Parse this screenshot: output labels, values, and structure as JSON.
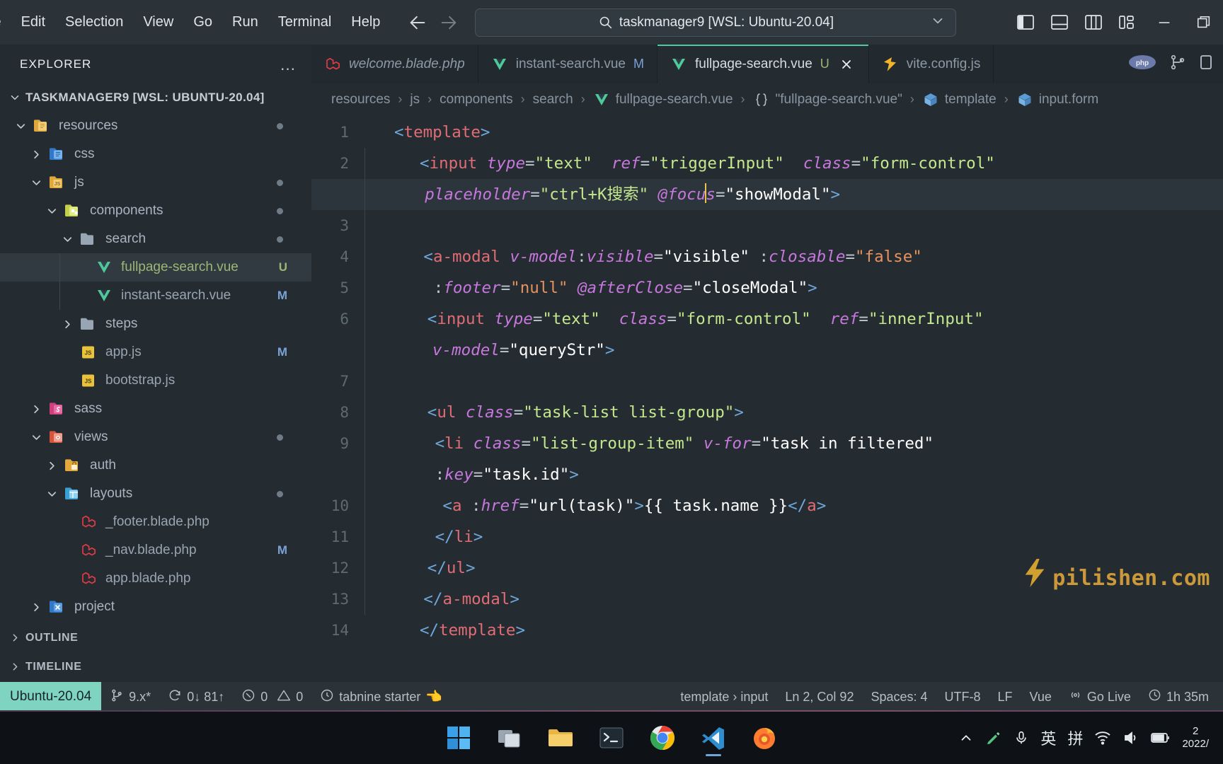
{
  "titlebar": {
    "menus": [
      "le",
      "Edit",
      "Selection",
      "View",
      "Go",
      "Run",
      "Terminal",
      "Help"
    ],
    "back_icon": "arrow-left-icon",
    "forward_icon": "arrow-right-icon",
    "search_value": "taskmanager9 [WSL: Ubuntu-20.04]",
    "search_icon": "search-icon",
    "chevron_icon": "chevron-down-icon",
    "layout_icons": [
      "toggle-primary-sidebar-icon",
      "toggle-panel-icon",
      "toggle-secondary-sidebar-icon",
      "customize-layout-icon"
    ],
    "minimize": "minimize-icon",
    "maximize": "maximize-icon"
  },
  "sidebar": {
    "title": "EXPLORER",
    "more_actions": "…",
    "root": "TASKMANAGER9 [WSL: UBUNTU-20.04]",
    "tree": [
      {
        "label": "resources",
        "icon": "folder-resources-icon",
        "indent": 1,
        "arrow": "down",
        "kind": "folder",
        "dot": true
      },
      {
        "label": "css",
        "icon": "folder-css-icon",
        "indent": 2,
        "arrow": "right",
        "kind": "folder"
      },
      {
        "label": "js",
        "icon": "folder-js-icon",
        "indent": 2,
        "arrow": "down",
        "kind": "folder",
        "dot": true
      },
      {
        "label": "components",
        "icon": "folder-components-icon",
        "indent": 3,
        "arrow": "down",
        "kind": "folder",
        "dot": true
      },
      {
        "label": "search",
        "icon": "folder-plain-icon",
        "indent": 4,
        "arrow": "down",
        "kind": "folder",
        "dot": true
      },
      {
        "label": "fullpage-search.vue",
        "icon": "vue-file-icon",
        "indent": 5,
        "arrow": "none",
        "kind": "file-vue",
        "badge": "U",
        "badge_color": "#9bb774",
        "selected": true
      },
      {
        "label": "instant-search.vue",
        "icon": "vue-file-icon",
        "indent": 5,
        "arrow": "none",
        "kind": "file-vue",
        "badge": "M",
        "badge_color": "#7aa2d6"
      },
      {
        "label": "steps",
        "icon": "folder-plain-icon",
        "indent": 4,
        "arrow": "right",
        "kind": "folder"
      },
      {
        "label": "app.js",
        "icon": "js-file-icon",
        "indent": 4,
        "arrow": "none",
        "kind": "file",
        "badge": "M",
        "badge_color": "#7aa2d6"
      },
      {
        "label": "bootstrap.js",
        "icon": "js-file-icon",
        "indent": 4,
        "arrow": "none",
        "kind": "file"
      },
      {
        "label": "sass",
        "icon": "folder-sass-icon",
        "indent": 2,
        "arrow": "right",
        "kind": "folder"
      },
      {
        "label": "views",
        "icon": "folder-views-icon",
        "indent": 2,
        "arrow": "down",
        "kind": "folder",
        "dot": true
      },
      {
        "label": "auth",
        "icon": "folder-auth-icon",
        "indent": 3,
        "arrow": "right",
        "kind": "folder"
      },
      {
        "label": "layouts",
        "icon": "folder-layouts-icon",
        "indent": 3,
        "arrow": "down",
        "kind": "folder",
        "dot": true
      },
      {
        "label": "_footer.blade.php",
        "icon": "laravel-file-icon",
        "indent": 4,
        "arrow": "none",
        "kind": "file"
      },
      {
        "label": "_nav.blade.php",
        "icon": "laravel-file-icon",
        "indent": 4,
        "arrow": "none",
        "kind": "file",
        "badge": "M",
        "badge_color": "#7aa2d6"
      },
      {
        "label": "app.blade.php",
        "icon": "laravel-file-icon",
        "indent": 4,
        "arrow": "none",
        "kind": "file"
      },
      {
        "label": "project",
        "icon": "folder-project-icon",
        "indent": 2,
        "arrow": "right",
        "kind": "folder"
      }
    ],
    "sections": [
      "OUTLINE",
      "TIMELINE"
    ]
  },
  "tabs": [
    {
      "label": "welcome.blade.php",
      "icon": "laravel-file-icon",
      "italic": true,
      "active": false,
      "mark": ""
    },
    {
      "label": "instant-search.vue",
      "icon": "vue-file-icon",
      "italic": false,
      "active": false,
      "mark": "M",
      "mark_color": "#7aa2d6"
    },
    {
      "label": "fullpage-search.vue",
      "icon": "vue-file-icon",
      "italic": false,
      "active": true,
      "mark": "U",
      "mark_color": "#9bb774",
      "closable": true
    },
    {
      "label": "vite.config.js",
      "icon": "vite-file-icon",
      "italic": false,
      "active": false,
      "mark": ""
    }
  ],
  "tab_actions": [
    "php-badge-icon",
    "split-editor-icon",
    "more-actions-icon"
  ],
  "breadcrumb": [
    {
      "label": "resources",
      "icon": ""
    },
    {
      "label": "js",
      "icon": ""
    },
    {
      "label": "components",
      "icon": ""
    },
    {
      "label": "search",
      "icon": ""
    },
    {
      "label": "fullpage-search.vue",
      "icon": "vue-file-icon"
    },
    {
      "label": "\"fullpage-search.vue\"",
      "icon": "braces-icon"
    },
    {
      "label": "template",
      "icon": "symbol-module-icon"
    },
    {
      "label": "input.form",
      "icon": "symbol-module-icon"
    }
  ],
  "code": {
    "lines": [
      {
        "num": "1",
        "highlight": false,
        "indent_guides": 0,
        "tokens": [
          {
            "t": "<",
            "c": "br"
          },
          {
            "t": "template",
            "c": "tag"
          },
          {
            "t": ">",
            "c": "br"
          }
        ],
        "pad": 0
      },
      {
        "num": "2",
        "highlight": false,
        "indent_guides": 1,
        "tokens": [
          {
            "t": "<",
            "c": "br"
          },
          {
            "t": "input",
            "c": "tag"
          },
          {
            "t": " ",
            "c": "p"
          },
          {
            "t": "type",
            "c": "attr"
          },
          {
            "t": "=",
            "c": "eq"
          },
          {
            "t": "\"text\"",
            "c": "str"
          },
          {
            "t": "  ",
            "c": "p"
          },
          {
            "t": "ref",
            "c": "attr"
          },
          {
            "t": "=",
            "c": "eq"
          },
          {
            "t": "\"triggerInput\"",
            "c": "str"
          },
          {
            "t": "  ",
            "c": "p"
          },
          {
            "t": "class",
            "c": "attr"
          },
          {
            "t": "=",
            "c": "eq"
          },
          {
            "t": "\"form-control\"",
            "c": "str"
          }
        ],
        "pad": 1
      },
      {
        "num": "",
        "highlight": true,
        "indent_guides": 1,
        "tokens": [
          {
            "t": "placeholder",
            "c": "attr"
          },
          {
            "t": "=",
            "c": "eq"
          },
          {
            "t": "\"ctrl+K搜索\"",
            "c": "str"
          },
          {
            "t": " ",
            "c": "p"
          },
          {
            "t": "@focu",
            "c": "attr"
          },
          {
            "t": "|CURSOR|",
            "c": "cursor"
          },
          {
            "t": "s",
            "c": "attr"
          },
          {
            "t": "=",
            "c": "eq"
          },
          {
            "t": "\"showModal\"",
            "c": "expr"
          },
          {
            "t": ">",
            "c": "br"
          }
        ],
        "pad": 1.2
      },
      {
        "num": "3",
        "highlight": false,
        "indent_guides": 1,
        "tokens": [],
        "pad": 1
      },
      {
        "num": "4",
        "highlight": false,
        "indent_guides": 1,
        "tokens": [
          {
            "t": "<",
            "c": "br"
          },
          {
            "t": "a-modal",
            "c": "tag"
          },
          {
            "t": " ",
            "c": "p"
          },
          {
            "t": "v-model",
            "c": "attr"
          },
          {
            "t": ":",
            "c": "eq"
          },
          {
            "t": "visible",
            "c": "attr"
          },
          {
            "t": "=",
            "c": "eq"
          },
          {
            "t": "\"visible\"",
            "c": "expr"
          },
          {
            "t": " ",
            "c": "p"
          },
          {
            "t": ":",
            "c": "eq"
          },
          {
            "t": "closable",
            "c": "attr"
          },
          {
            "t": "=",
            "c": "eq"
          },
          {
            "t": "\"false\"",
            "c": "bool"
          }
        ],
        "pad": 1.15
      },
      {
        "num": "5",
        "highlight": false,
        "indent_guides": 1,
        "tokens": [
          {
            "t": ":",
            "c": "eq"
          },
          {
            "t": "footer",
            "c": "attr"
          },
          {
            "t": "=",
            "c": "eq"
          },
          {
            "t": "\"null\"",
            "c": "bool"
          },
          {
            "t": " ",
            "c": "p"
          },
          {
            "t": "@afterClose",
            "c": "attr"
          },
          {
            "t": "=",
            "c": "eq"
          },
          {
            "t": "\"closeModal\"",
            "c": "expr"
          },
          {
            "t": ">",
            "c": "br"
          }
        ],
        "pad": 1.55
      },
      {
        "num": "6",
        "highlight": false,
        "indent_guides": 1,
        "tokens": [
          {
            "t": "<",
            "c": "br"
          },
          {
            "t": "input",
            "c": "tag"
          },
          {
            "t": " ",
            "c": "p"
          },
          {
            "t": "type",
            "c": "attr"
          },
          {
            "t": "=",
            "c": "eq"
          },
          {
            "t": "\"text\"",
            "c": "str"
          },
          {
            "t": "  ",
            "c": "p"
          },
          {
            "t": "class",
            "c": "attr"
          },
          {
            "t": "=",
            "c": "eq"
          },
          {
            "t": "\"form-control\"",
            "c": "str"
          },
          {
            "t": "  ",
            "c": "p"
          },
          {
            "t": "ref",
            "c": "attr"
          },
          {
            "t": "=",
            "c": "eq"
          },
          {
            "t": "\"innerInput\"",
            "c": "str"
          }
        ],
        "pad": 1.3
      },
      {
        "num": "",
        "highlight": false,
        "indent_guides": 1,
        "tokens": [
          {
            "t": "v-model",
            "c": "attr"
          },
          {
            "t": "=",
            "c": "eq"
          },
          {
            "t": "\"queryStr\"",
            "c": "expr"
          },
          {
            "t": ">",
            "c": "br"
          }
        ],
        "pad": 1.5
      },
      {
        "num": "7",
        "highlight": false,
        "indent_guides": 1,
        "tokens": [],
        "pad": 1
      },
      {
        "num": "8",
        "highlight": false,
        "indent_guides": 1,
        "tokens": [
          {
            "t": "<",
            "c": "br"
          },
          {
            "t": "ul",
            "c": "tag"
          },
          {
            "t": " ",
            "c": "p"
          },
          {
            "t": "class",
            "c": "attr"
          },
          {
            "t": "=",
            "c": "eq"
          },
          {
            "t": "\"task-list list-group\"",
            "c": "str"
          },
          {
            "t": ">",
            "c": "br"
          }
        ],
        "pad": 1.3
      },
      {
        "num": "9",
        "highlight": false,
        "indent_guides": 1,
        "tokens": [
          {
            "t": "<",
            "c": "br"
          },
          {
            "t": "li",
            "c": "tag"
          },
          {
            "t": " ",
            "c": "p"
          },
          {
            "t": "class",
            "c": "attr"
          },
          {
            "t": "=",
            "c": "eq"
          },
          {
            "t": "\"list-group-item\"",
            "c": "str"
          },
          {
            "t": " ",
            "c": "p"
          },
          {
            "t": "v-for",
            "c": "attr"
          },
          {
            "t": "=",
            "c": "eq"
          },
          {
            "t": "\"task in filtered\"",
            "c": "expr"
          }
        ],
        "pad": 1.6
      },
      {
        "num": "",
        "highlight": false,
        "indent_guides": 1,
        "tokens": [
          {
            "t": ":",
            "c": "eq"
          },
          {
            "t": "key",
            "c": "attr"
          },
          {
            "t": "=",
            "c": "eq"
          },
          {
            "t": "\"task.id\"",
            "c": "expr"
          },
          {
            "t": ">",
            "c": "br"
          }
        ],
        "pad": 1.6
      },
      {
        "num": "10",
        "highlight": false,
        "indent_guides": 1,
        "tokens": [
          {
            "t": "<",
            "c": "br"
          },
          {
            "t": "a",
            "c": "tag"
          },
          {
            "t": " ",
            "c": "p"
          },
          {
            "t": ":",
            "c": "eq"
          },
          {
            "t": "href",
            "c": "attr"
          },
          {
            "t": "=",
            "c": "eq"
          },
          {
            "t": "\"url(task)\"",
            "c": "expr"
          },
          {
            "t": ">",
            "c": "br"
          },
          {
            "t": "{{ task.name }}",
            "c": "mus"
          },
          {
            "t": "</",
            "c": "br"
          },
          {
            "t": "a",
            "c": "tag"
          },
          {
            "t": ">",
            "c": "br"
          }
        ],
        "pad": 1.9
      },
      {
        "num": "11",
        "highlight": false,
        "indent_guides": 1,
        "tokens": [
          {
            "t": "</",
            "c": "br"
          },
          {
            "t": "li",
            "c": "tag"
          },
          {
            "t": ">",
            "c": "br"
          }
        ],
        "pad": 1.6
      },
      {
        "num": "12",
        "highlight": false,
        "indent_guides": 1,
        "tokens": [
          {
            "t": "</",
            "c": "br"
          },
          {
            "t": "ul",
            "c": "tag"
          },
          {
            "t": ">",
            "c": "br"
          }
        ],
        "pad": 1.3
      },
      {
        "num": "13",
        "highlight": false,
        "indent_guides": 1,
        "tokens": [
          {
            "t": "</",
            "c": "br"
          },
          {
            "t": "a-modal",
            "c": "tag"
          },
          {
            "t": ">",
            "c": "br"
          }
        ],
        "pad": 1.15
      },
      {
        "num": "14",
        "highlight": false,
        "indent_guides": 0,
        "tokens": [
          {
            "t": "</",
            "c": "br"
          },
          {
            "t": "template",
            "c": "tag"
          },
          {
            "t": ">",
            "c": "br"
          }
        ],
        "pad": 1
      }
    ]
  },
  "watermark": {
    "text": "pilishen.com",
    "icon": "lightning-bolt-icon"
  },
  "statusbar": {
    "remote": "Ubuntu-20.04",
    "left": [
      {
        "icon": "source-control-branch-icon",
        "label": "9.x*"
      },
      {
        "icon": "sync-icon",
        "label": "0↓ 81↑"
      },
      {
        "icon": "error-icon",
        "label": "0",
        "icon2": "warning-icon",
        "label2": "0"
      },
      {
        "icon": "tabnine-icon",
        "label": "tabnine starter",
        "emoji": "👈"
      }
    ],
    "right": [
      {
        "label": "template › input"
      },
      {
        "label": "Ln 2, Col 92"
      },
      {
        "label": "Spaces: 4"
      },
      {
        "label": "UTF-8"
      },
      {
        "label": "LF"
      },
      {
        "label": "Vue"
      },
      {
        "icon": "broadcast-icon",
        "label": "Go Live"
      },
      {
        "icon": "clock-icon",
        "label": "1h 35m"
      }
    ]
  },
  "taskbar": {
    "apps": [
      {
        "name": "windows-start-icon",
        "active": false
      },
      {
        "name": "task-view-icon",
        "active": false
      },
      {
        "name": "file-explorer-icon",
        "active": false
      },
      {
        "name": "terminal-icon",
        "active": false
      },
      {
        "name": "chrome-icon",
        "active": false
      },
      {
        "name": "vscode-icon",
        "active": true
      },
      {
        "name": "firefox-icon",
        "active": false
      }
    ],
    "tray": [
      "chevron-up-icon",
      "pen-icon",
      "microphone-icon"
    ],
    "ime": [
      "英",
      "拼"
    ],
    "status": [
      "wifi-icon",
      "volume-icon",
      "battery-icon"
    ],
    "clock_top": "2",
    "clock_bottom": "2022/"
  }
}
